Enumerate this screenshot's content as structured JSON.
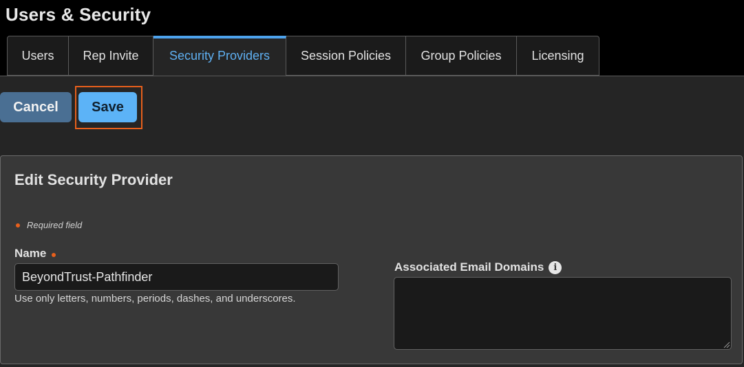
{
  "page": {
    "title": "Users & Security"
  },
  "tabs": [
    {
      "label": "Users"
    },
    {
      "label": "Rep Invite"
    },
    {
      "label": "Security Providers",
      "active": true
    },
    {
      "label": "Session Policies"
    },
    {
      "label": "Group Policies"
    },
    {
      "label": "Licensing"
    }
  ],
  "actions": {
    "cancel_label": "Cancel",
    "save_label": "Save"
  },
  "panel": {
    "title": "Edit Security Provider",
    "required_note": "Required field",
    "name_label": "Name",
    "name_value": "BeyondTrust-Pathfinder",
    "name_hint": "Use only letters, numbers, periods, dashes, and underscores.",
    "domains_label": "Associated Email Domains",
    "domains_value": "",
    "info_icon": "info-icon"
  },
  "colors": {
    "accent": "#4da2ec",
    "active_tab_text": "#5fb0f2",
    "save_button": "#5cb3f7",
    "cancel_button": "#4a6f93",
    "required_indicator": "#e8601c",
    "highlight_border": "#e8601c",
    "panel_bg": "#383838"
  }
}
